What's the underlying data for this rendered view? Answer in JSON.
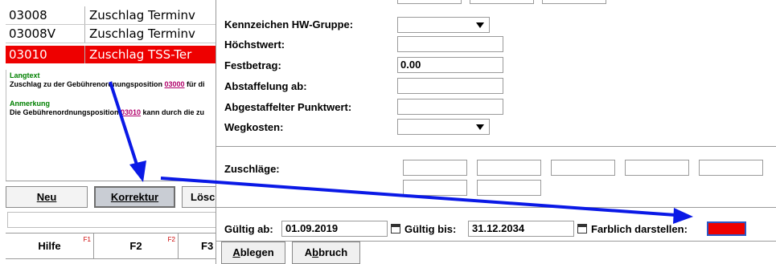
{
  "codes": [
    {
      "code": "03008",
      "desc": "Zuschlag Terminv"
    },
    {
      "code": "03008V",
      "desc": "Zuschlag Terminv"
    },
    {
      "code": "03010",
      "desc": "Zuschlag TSS-Ter"
    }
  ],
  "info": {
    "langtext_heading": "Langtext",
    "langtext_pre": "Zuschlag zu der Gebührenordnungsposition ",
    "langtext_link": "03000",
    "langtext_post": " für di",
    "anmerkung_heading": "Anmerkung",
    "anmerkung_pre": "Die Gebührenordnungsposition ",
    "anmerkung_link": "03010",
    "anmerkung_post": " kann durch die zu"
  },
  "left_buttons": {
    "neu": "Neu",
    "korrektur": "Korrektur",
    "loeschen": "Lösc"
  },
  "fkeys": [
    {
      "label": "Hilfe",
      "key": "F1"
    },
    {
      "label": "F2",
      "key": "F2"
    },
    {
      "label": "F3",
      "key": ""
    }
  ],
  "form": {
    "kennzeichen_label": "Kennzeichen HW-Gruppe:",
    "hoechstwert_label": "Höchstwert:",
    "festbetrag_label": "Festbetrag:",
    "festbetrag_value": "0.00",
    "abstaffelung_label": "Abstaffelung ab:",
    "abgestaffelter_label": "Abgestaffelter Punktwert:",
    "wegkosten_label": "Wegkosten:",
    "zuschlaege_label": "Zuschläge:",
    "gueltig_ab_label": "Gültig ab:",
    "gueltig_ab_value": "01.09.2019",
    "gueltig_bis_label": "Gültig bis:",
    "gueltig_bis_value": "31.12.2034",
    "farblich_label": "Farblich darstellen:",
    "farblich_color": "#ee0000"
  },
  "right_buttons": {
    "ablegen_first": "A",
    "ablegen_rest": "blegen",
    "abbruch_first": "A",
    "abbruch_u": "b",
    "abbruch_rest": "bruch"
  },
  "colors": {
    "selection": "#ee0000",
    "link": "#b0006a",
    "heading_green": "#008000",
    "arrow": "#0a19e6"
  }
}
